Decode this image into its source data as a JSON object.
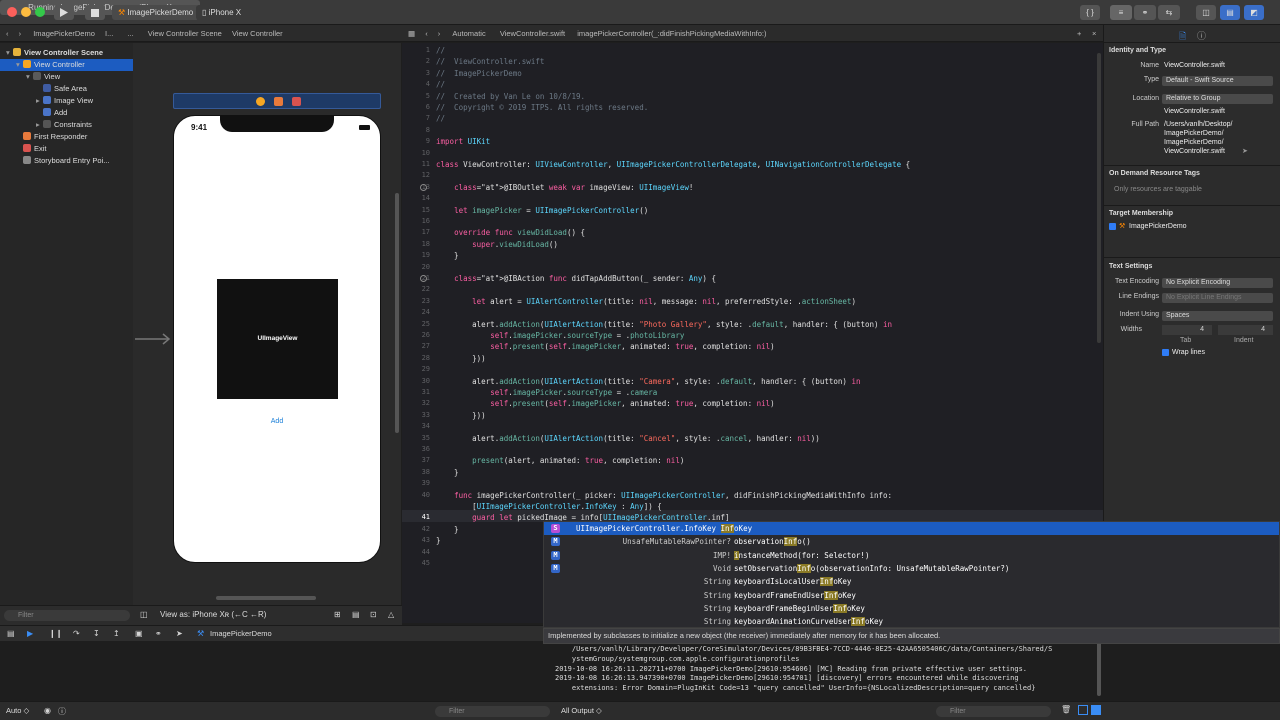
{
  "toolbar": {
    "scheme": "ImagePickerDemo",
    "device": "iPhone X",
    "status": "Running ImagePickerDemo on iPhone X"
  },
  "nav_jump": {
    "project": "ImagePickerDemo",
    "folder": "I...",
    "ellipsis": "...",
    "scene": "View Controller Scene",
    "vc": "View Controller"
  },
  "editor_jump": {
    "mode": "Automatic",
    "file": "ViewController.swift",
    "method": "imagePickerController(_:didFinishPickingMediaWithInfo:)"
  },
  "outline": [
    {
      "label": "View Controller Scene",
      "level": 0
    },
    {
      "label": "View Controller",
      "level": 1
    },
    {
      "label": "View",
      "level": 2
    },
    {
      "label": "Safe Area",
      "level": 3
    },
    {
      "label": "Image View",
      "level": 3
    },
    {
      "label": "Add",
      "level": 3
    },
    {
      "label": "Constraints",
      "level": 3
    },
    {
      "label": "First Responder",
      "level": 1
    },
    {
      "label": "Exit",
      "level": 1
    },
    {
      "label": "Storyboard Entry Poi...",
      "level": 1
    }
  ],
  "canvas": {
    "time": "9:41",
    "image_view_label": "UIImageView",
    "add_button": "Add",
    "view_as": "View as: iPhone Xʀ (←C ←R)"
  },
  "code": [
    {
      "n": "1",
      "t": "//"
    },
    {
      "n": "2",
      "t": "//  ViewController.swift"
    },
    {
      "n": "3",
      "t": "//  ImagePickerDemo"
    },
    {
      "n": "4",
      "t": "//"
    },
    {
      "n": "5",
      "t": "//  Created by Van Le on 10/8/19."
    },
    {
      "n": "6",
      "t": "//  Copyright © 2019 ITPS. All rights reserved."
    },
    {
      "n": "7",
      "t": "//"
    },
    {
      "n": "8",
      "t": ""
    },
    {
      "n": "9",
      "t": "import UIKit"
    },
    {
      "n": "10",
      "t": ""
    },
    {
      "n": "11",
      "t": "class ViewController: UIViewController, UIImagePickerControllerDelegate, UINavigationControllerDelegate {"
    },
    {
      "n": "12",
      "t": ""
    },
    {
      "n": "13",
      "t": "    @IBOutlet weak var imageView: UIImageView!"
    },
    {
      "n": "14",
      "t": ""
    },
    {
      "n": "15",
      "t": "    let imagePicker = UIImagePickerController()"
    },
    {
      "n": "16",
      "t": ""
    },
    {
      "n": "17",
      "t": "    override func viewDidLoad() {"
    },
    {
      "n": "18",
      "t": "        super.viewDidLoad()"
    },
    {
      "n": "19",
      "t": "    }"
    },
    {
      "n": "20",
      "t": ""
    },
    {
      "n": "21",
      "t": "    @IBAction func didTapAddButton(_ sender: Any) {"
    },
    {
      "n": "22",
      "t": ""
    },
    {
      "n": "23",
      "t": "        let alert = UIAlertController(title: nil, message: nil, preferredStyle: .actionSheet)"
    },
    {
      "n": "24",
      "t": ""
    },
    {
      "n": "25",
      "t": "        alert.addAction(UIAlertAction(title: \"Photo Gallery\", style: .default, handler: { (button) in"
    },
    {
      "n": "26",
      "t": "            self.imagePicker.sourceType = .photoLibrary"
    },
    {
      "n": "27",
      "t": "            self.present(self.imagePicker, animated: true, completion: nil)"
    },
    {
      "n": "28",
      "t": "        }))"
    },
    {
      "n": "29",
      "t": ""
    },
    {
      "n": "30",
      "t": "        alert.addAction(UIAlertAction(title: \"Camera\", style: .default, handler: { (button) in"
    },
    {
      "n": "31",
      "t": "            self.imagePicker.sourceType = .camera"
    },
    {
      "n": "32",
      "t": "            self.present(self.imagePicker, animated: true, completion: nil)"
    },
    {
      "n": "33",
      "t": "        }))"
    },
    {
      "n": "34",
      "t": ""
    },
    {
      "n": "35",
      "t": "        alert.addAction(UIAlertAction(title: \"Cancel\", style: .cancel, handler: nil))"
    },
    {
      "n": "36",
      "t": ""
    },
    {
      "n": "37",
      "t": "        present(alert, animated: true, completion: nil)"
    },
    {
      "n": "38",
      "t": "    }"
    },
    {
      "n": "39",
      "t": ""
    },
    {
      "n": "40",
      "t": "    func imagePickerController(_ picker: UIImagePickerController, didFinishPickingMediaWithInfo info:"
    },
    {
      "n": "",
      "t": "        [UIImagePickerController.InfoKey : Any]) {"
    },
    {
      "n": "41",
      "t": "        guard let pickedImage = info[UIImagePickerController.inf]"
    },
    {
      "n": "42",
      "t": "    }"
    },
    {
      "n": "43",
      "t": "}"
    },
    {
      "n": "44",
      "t": ""
    },
    {
      "n": "45",
      "t": ""
    }
  ],
  "completions": [
    {
      "badge": "S",
      "type": "",
      "pre": "UIImagePickerController.InfoKey ",
      "match": "Inf",
      "post": "oKey"
    },
    {
      "badge": "M",
      "type": "UnsafeMutableRawPointer?",
      "pre": "observation",
      "match": "Inf",
      "post": "o()"
    },
    {
      "badge": "M",
      "type": "IMP!",
      "pre": "",
      "match": "i",
      "post": "nstanceMethod(for: Selector!)"
    },
    {
      "badge": "M",
      "type": "Void",
      "pre": "setObservation",
      "match": "Inf",
      "post": "o(observationInfo: UnsafeMutableRawPointer?)"
    },
    {
      "badge": "",
      "type": "String",
      "pre": "keyboardIsLocalUser",
      "match": "Inf",
      "post": "oKey"
    },
    {
      "badge": "",
      "type": "String",
      "pre": "keyboardFrameEndUser",
      "match": "Inf",
      "post": "oKey"
    },
    {
      "badge": "",
      "type": "String",
      "pre": "keyboardFrameBeginUser",
      "match": "Inf",
      "post": "oKey"
    },
    {
      "badge": "",
      "type": "String",
      "pre": "keyboardAnimationCurveUser",
      "match": "Inf",
      "post": "oKey"
    }
  ],
  "completion_doc": "Implemented by subclasses to initialize a new object (the receiver) immediately after memory for it has been allocated.",
  "console_lines": [
    "    /Users/vanlh/Library/Developer/CoreSimulator/Devices/89B3FBE4-7CCD-4446-8E25-42AA6505406C/data/Containers/Shared/S",
    "    ystemGroup/systemgroup.com.apple.configurationprofiles",
    "2019-10-08 16:26:11.202711+0700 ImagePickerDemo[29610:954606] [MC] Reading from private effective user settings.",
    "2019-10-08 16:26:13.947390+0700 ImagePickerDemo[29610:954701] [discovery] errors encountered while discovering",
    "    extensions: Error Domain=PlugInKit Code=13 \"query cancelled\" UserInfo={NSLocalizedDescription=query cancelled}"
  ],
  "inspector": {
    "identity_title": "Identity and Type",
    "name_label": "Name",
    "name_value": "ViewController.swift",
    "type_label": "Type",
    "type_value": "Default - Swift Source",
    "location_label": "Location",
    "location_value": "Relative to Group",
    "location_file": "ViewController.swift",
    "fullpath_label": "Full Path",
    "fullpath_lines": [
      "/Users/vanlh/Desktop/",
      "ImagePickerDemo/",
      "ImagePickerDemo/",
      "ViewController.swift"
    ],
    "odr_title": "On Demand Resource Tags",
    "odr_placeholder": "Only resources are taggable",
    "target_title": "Target Membership",
    "target_item": "ImagePickerDemo",
    "text_title": "Text Settings",
    "encoding_label": "Text Encoding",
    "encoding_value": "No Explicit Encoding",
    "endings_label": "Line Endings",
    "endings_value": "No Explicit Line Endings",
    "indent_label": "Indent Using",
    "indent_value": "Spaces",
    "widths_label": "Widths",
    "tab_value": "4",
    "indent_width_value": "4",
    "tab_label": "Tab",
    "indent_label2": "Indent",
    "wrap_label": "Wrap lines"
  },
  "debug": {
    "process": "ImagePickerDemo",
    "auto": "Auto ◇",
    "output": "All Output ◇",
    "filter": "Filter"
  }
}
